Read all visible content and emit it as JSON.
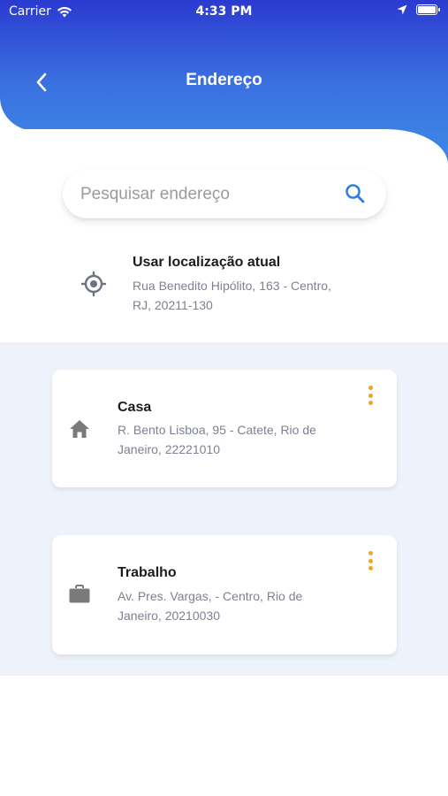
{
  "status_bar": {
    "carrier": "Carrier",
    "time": "4:33 PM"
  },
  "header": {
    "title": "Endereço"
  },
  "search": {
    "placeholder": "Pesquisar endereço"
  },
  "current_location": {
    "title": "Usar localização atual",
    "address": "Rua Benedito Hipólito, 163 - Centro, RJ, 20211-130"
  },
  "addresses": [
    {
      "name": "Casa",
      "address": "R. Bento Lisboa, 95 - Catete, Rio de Janeiro, 22221010",
      "icon": "home-icon"
    },
    {
      "name": "Trabalho",
      "address": "Av. Pres. Vargas,  - Centro, Rio de Janeiro, 20210030",
      "icon": "briefcase-icon"
    }
  ],
  "colors": {
    "header_gradient_top": "#2b3ad0",
    "header_gradient_bottom": "#3d8fe6",
    "accent_blue": "#2f7fe0",
    "more_dots": "#f3a51d",
    "list_background": "#eef3fb",
    "secondary_text": "#7d8191"
  }
}
